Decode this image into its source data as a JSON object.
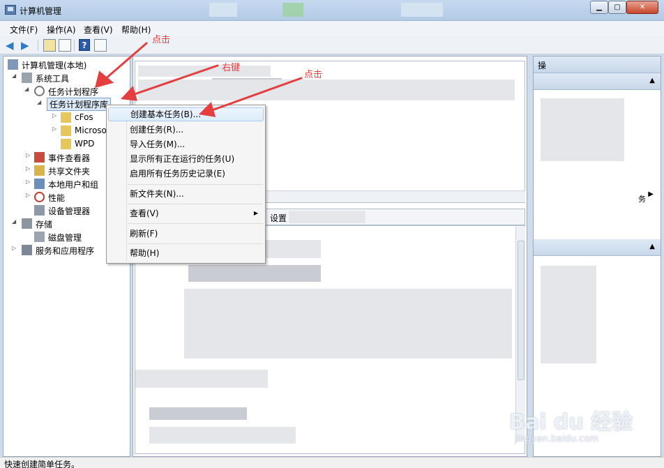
{
  "window": {
    "title": "计算机管理"
  },
  "menubar": [
    {
      "label": "文件(F)"
    },
    {
      "label": "操作(A)"
    },
    {
      "label": "查看(V)"
    },
    {
      "label": "帮助(H)"
    }
  ],
  "toolbar": {
    "help_label": "?"
  },
  "tree": {
    "root": "计算机管理(本地)",
    "system_tools": "系统工具",
    "task_scheduler": "任务计划程序",
    "task_library": "任务计划程序库",
    "cfos": "cFos",
    "microsoft": "Microsof",
    "wpd": "WPD",
    "event_viewer": "事件查看器",
    "shared_folders": "共享文件夹",
    "local_users": "本地用户和组",
    "performance": "性能",
    "device_manager": "设备管理器",
    "storage": "存储",
    "disk_management": "磁盘管理",
    "services": "服务和应用程序"
  },
  "center": {
    "tab_settings": "设置"
  },
  "actions": {
    "header": "操",
    "overflow_text": "务"
  },
  "context_menu": {
    "items": [
      {
        "label": "创建基本任务(B)..."
      },
      {
        "label": "创建任务(R)..."
      },
      {
        "label": "导入任务(M)..."
      },
      {
        "label": "显示所有正在运行的任务(U)"
      },
      {
        "label": "启用所有任务历史记录(E)"
      },
      {
        "label": "新文件夹(N)..."
      },
      {
        "label": "查看(V)"
      },
      {
        "label": "刷新(F)"
      },
      {
        "label": "帮助(H)"
      }
    ]
  },
  "annotations": {
    "click_1": "点击",
    "right_click": "右键",
    "click_2": "点击",
    "color": "#e53e3e"
  },
  "statusbar": {
    "text": "快速创建简单任务。"
  },
  "watermark": {
    "logo": "Bai du 经验",
    "url": "jingyan.baidu.com"
  }
}
